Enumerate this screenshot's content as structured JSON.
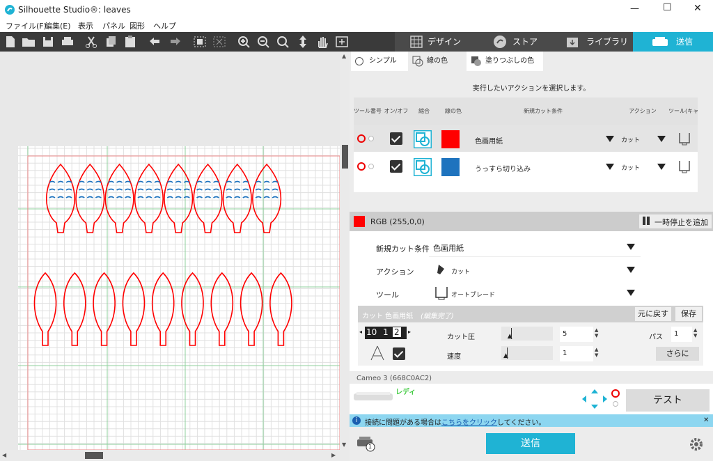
{
  "window": {
    "title": "Silhouette Studio®: leaves",
    "min": "—",
    "max": "☐",
    "close": "✕"
  },
  "menu": [
    "ファイル(F)",
    "編集(E)",
    "表示",
    "パネル",
    "図形",
    "ヘルプ"
  ],
  "nav": {
    "design": "デザイン",
    "store": "ストア",
    "library": "ライブラリ",
    "send": "送信"
  },
  "colors": {
    "accent": "#1fb3d4",
    "cut_red": "#ff0000",
    "cut_blue": "#1e73be",
    "dark": "#3a3a3a"
  },
  "panel_tabs": {
    "simple": "シンプル",
    "line_color": "線の色",
    "fill_color": "塗りつぶしの色"
  },
  "instruction": "実行したいアクションを選択します。",
  "table": {
    "headers": [
      "ツール番号",
      "オン/オフ",
      "縮合",
      "線の色",
      "新規カット条件",
      "アクション",
      "ツール(キャリッジ)"
    ],
    "rows": [
      {
        "condition": "色画用紙",
        "action": "カット",
        "color": "#ff0000",
        "on": true
      },
      {
        "condition": "うっすら切り込み",
        "action": "カット",
        "color": "#1e73be",
        "on": true
      }
    ]
  },
  "rgb_label": "RGB (255,0,0)",
  "pause_label": "一時停止を追加",
  "settings": {
    "cond_label": "新規カット条件",
    "cond_value": "色画用紙",
    "action_label": "アクション",
    "action_value": "カット",
    "tool_label": "ツール",
    "tool_value": "オートブレード"
  },
  "detail": {
    "header": "カット 色画用紙",
    "header_note": "(編集完了)",
    "revert": "元に戻す",
    "save": "保存",
    "blade_digits": [
      "10",
      "1",
      "2"
    ],
    "pressure_label": "カット圧",
    "pressure_value": "5",
    "pressure_level": 0.1,
    "speed_label": "速度",
    "speed_value": "1",
    "speed_level": 0.0,
    "pass_label": "パス",
    "pass_value": "1",
    "more": "さらに"
  },
  "device": {
    "name": "Cameo 3 (668C0AC2)",
    "status": "レディ",
    "test": "テスト"
  },
  "info": {
    "before": "接続に問題がある場合は",
    "link": "こちらをクリック",
    "after": "してください。",
    "close": "✕"
  },
  "send_button": "送信",
  "printer_badge": "1"
}
